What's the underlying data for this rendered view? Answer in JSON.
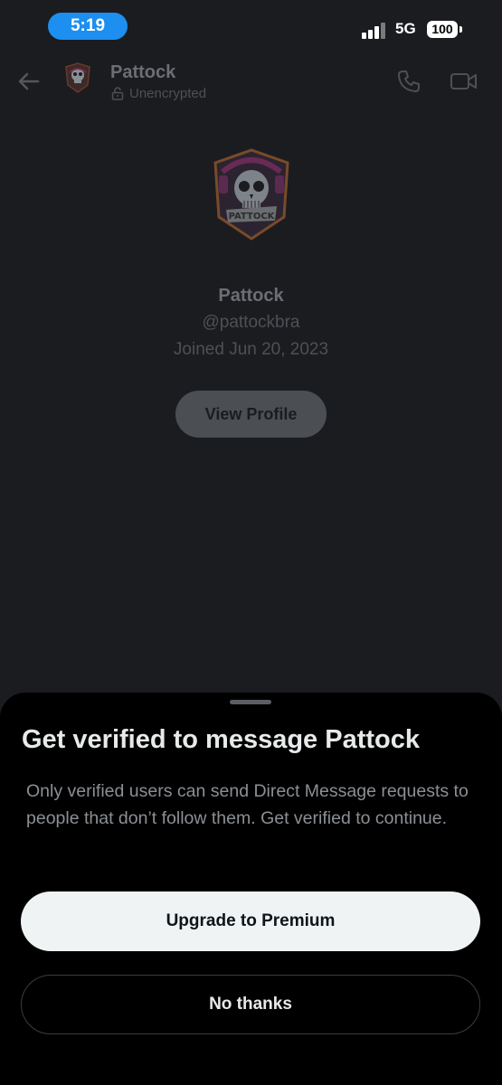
{
  "status_bar": {
    "time": "5:19",
    "network": "5G",
    "battery": "100"
  },
  "header": {
    "name": "Pattock",
    "encryption": "Unencrypted"
  },
  "profile": {
    "name": "Pattock",
    "handle": "@pattockbra",
    "joined": "Joined Jun 20, 2023",
    "view_profile_label": "View Profile"
  },
  "sheet": {
    "title": "Get verified to message Pattock",
    "body": "Only verified users can send Direct Message requests to people that don’t follow them.  Get verified to continue.",
    "upgrade_label": "Upgrade to Premium",
    "no_thanks_label": "No thanks"
  },
  "colors": {
    "background": "#1b1c20",
    "sheet": "#000000",
    "time_pill": "#1d8ff0",
    "primary_button": "#eff3f4"
  }
}
